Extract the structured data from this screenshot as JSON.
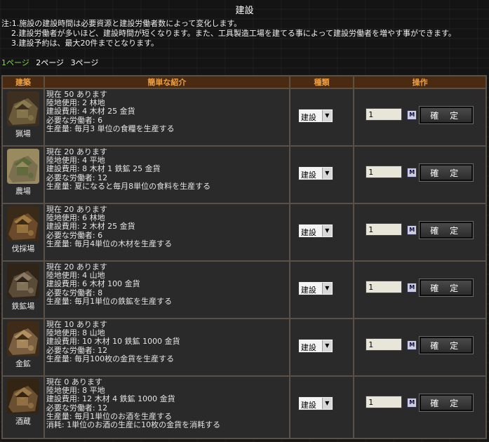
{
  "title": "建設",
  "notes": [
    "注:1.施設の建設時間は必要資源と建設労働者数によって変化します。",
    "2.建設労働者が多いほど、建設時間が短くなります。また、工具製造工場を建てる事によって建設労働者を増やす事ができます。",
    "3.建設予約は、最大20件までとなります。"
  ],
  "pages": [
    "1ページ",
    "2ページ",
    "3ページ"
  ],
  "headers": {
    "building": "建築",
    "intro": "簡単な紹介",
    "kind": "種類",
    "op": "操作"
  },
  "ok_label": "確 定",
  "max_label": "M",
  "buildings": [
    {
      "name": "猟場",
      "icon": "hunting-ground-icon",
      "lines": [
        "現在 50 あります",
        "陸地使用: 2 林地",
        "建設費用: 4 木材 25 金貨",
        "必要な労働者: 6",
        "生産量: 毎月3 単位の食糧を生産する"
      ],
      "kind": "建設",
      "qty": "1",
      "colors": [
        "#6b5a3a",
        "#8a7a50",
        "#3d3020"
      ]
    },
    {
      "name": "農場",
      "icon": "farm-icon",
      "lines": [
        "現在 20 あります",
        "陸地使用: 4 平地",
        "建設費用: 8 木材 1 鉄鉱 25 金貨",
        "必要な労働者: 12",
        "生産量: 夏になると毎月8単位の食料を生産する"
      ],
      "kind": "建設",
      "qty": "1",
      "colors": [
        "#7a7050",
        "#5c6a3a",
        "#9a8a60"
      ]
    },
    {
      "name": "伐採場",
      "icon": "lumber-camp-icon",
      "lines": [
        "現在 20 あります",
        "陸地使用: 6 林地",
        "建設費用: 2 木材 25 金貨",
        "必要な労働者: 6",
        "生産量: 毎月4単位の木材を生産する"
      ],
      "kind": "建設",
      "qty": "1",
      "colors": [
        "#6a4a2a",
        "#a07a40",
        "#3a2a18"
      ]
    },
    {
      "name": "鉄鉱場",
      "icon": "iron-mine-icon",
      "lines": [
        "現在 20 あります",
        "陸地使用: 4 山地",
        "建設費用: 6 木材 100 金貨",
        "必要な労働者: 8",
        "生産量: 毎月1単位の鉄鉱を生産する"
      ],
      "kind": "建設",
      "qty": "1",
      "colors": [
        "#5a4a38",
        "#8a7a62",
        "#2e2418"
      ]
    },
    {
      "name": "金鉱",
      "icon": "gold-mine-icon",
      "lines": [
        "現在 10 あります",
        "陸地使用: 8 山地",
        "建設費用: 10 木材 10 鉄鉱 1000 金貨",
        "必要な労働者: 12",
        "生産量: 毎月100枚の金貨を生産する"
      ],
      "kind": "建設",
      "qty": "1",
      "colors": [
        "#7a6040",
        "#b09060",
        "#3e2c18"
      ]
    },
    {
      "name": "酒蔵",
      "icon": "brewery-icon",
      "lines": [
        "現在 0 あります",
        "陸地使用: 8 平地",
        "建設費用: 12 木材 4 鉄鉱 1000 金貨",
        "必要な労働者: 12",
        "生産量: 毎月1単位のお酒を生産する",
        "消耗: 1単位のお酒の生産に10枚の金貨を消耗する"
      ],
      "kind": "建設",
      "qty": "1",
      "colors": [
        "#6a5030",
        "#9a7848",
        "#342414"
      ]
    }
  ]
}
